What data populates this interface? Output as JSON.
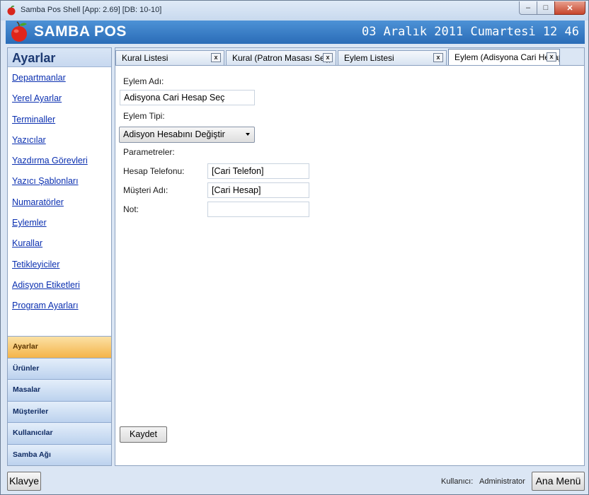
{
  "window": {
    "title": "Samba Pos Shell [App: 2.69] [DB: 10-10]",
    "controls": {
      "minimize": "–",
      "maximize": "□",
      "close": "✕"
    }
  },
  "banner": {
    "brand": "SAMBA POS",
    "datetime": "03 Aralık 2011 Cumartesi 12 46",
    "logo_icon": "apple-icon"
  },
  "sidebar": {
    "title": "Ayarlar",
    "links": [
      "Departmanlar",
      "Yerel Ayarlar",
      "Terminaller",
      "Yazıcılar",
      "Yazdırma Görevleri",
      "Yazıcı Şablonları",
      "Numaratörler",
      "Eylemler",
      "Kurallar",
      "Tetikleyiciler",
      "Adisyon Etiketleri",
      "Program Ayarları"
    ],
    "nav": [
      {
        "label": "Ayarlar",
        "active": true
      },
      {
        "label": "Ürünler",
        "active": false
      },
      {
        "label": "Masalar",
        "active": false
      },
      {
        "label": "Müşteriler",
        "active": false
      },
      {
        "label": "Kullanıcılar",
        "active": false
      },
      {
        "label": "Samba Ağı",
        "active": false
      }
    ]
  },
  "tabs": [
    {
      "label": "Kural Listesi",
      "close": "x",
      "active": false
    },
    {
      "label": "Kural (Patron Masası Seç)",
      "close": "x",
      "active": false
    },
    {
      "label": "Eylem Listesi",
      "close": "x",
      "active": false
    },
    {
      "label": "Eylem (Adisyona Cari Hesap Seç)",
      "close": "x",
      "active": true
    }
  ],
  "form": {
    "action_name_label": "Eylem Adı:",
    "action_name_value": "Adisyona Cari Hesap Seç",
    "action_type_label": "Eylem Tipi:",
    "action_type_value": "Adisyon Hesabını Değiştir",
    "parameters_label": "Parametreler:",
    "params": [
      {
        "label": "Hesap Telefonu:",
        "value": "[Cari Telefon]"
      },
      {
        "label": "Müşteri Adı:",
        "value": "[Cari Hesap]"
      },
      {
        "label": "Not:",
        "value": ""
      }
    ],
    "save_label": "Kaydet"
  },
  "statusbar": {
    "keyboard_label": "Klavye",
    "user_label": "Kullanıcı:",
    "user_value": "Administrator",
    "main_menu_label": "Ana Menü"
  },
  "colors": {
    "banner": "#2f74bf",
    "active_nav": "#f4b449",
    "link": "#0a2fb0"
  }
}
